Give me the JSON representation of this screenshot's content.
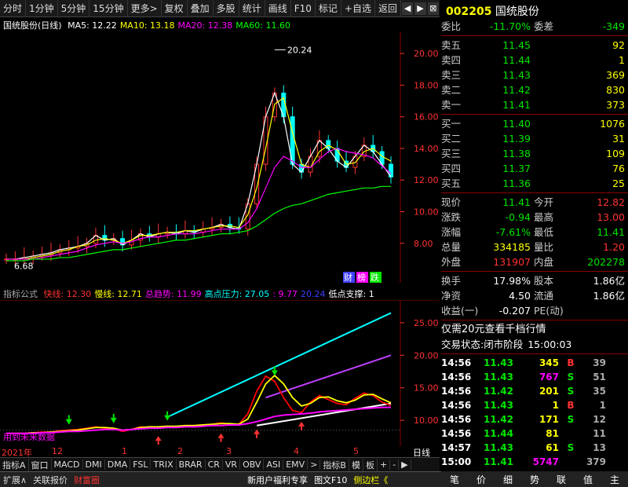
{
  "toolbar": {
    "items": [
      "分时",
      "1分钟",
      "5分钟",
      "15分钟",
      "更多>",
      "复权",
      "叠加",
      "多股",
      "统计",
      "画线",
      "F10",
      "标记",
      "+自选",
      "返回"
    ],
    "btns": [
      "◀",
      "▶",
      "⊠"
    ]
  },
  "symbol": {
    "code": "002205",
    "name": "国统股份"
  },
  "main": {
    "title": "国统股份(日线)",
    "ma": [
      {
        "label": "MA5: 12.22",
        "color": "#ffffff"
      },
      {
        "label": "MA10: 13.18",
        "color": "#ffff00"
      },
      {
        "label": "MA20: 12.38",
        "color": "#ff00ff"
      },
      {
        "label": "MA60: 11.60",
        "color": "#00ff00"
      }
    ],
    "high_label": "20.24",
    "low_label": "6.68",
    "price_axis": [
      "20.00",
      "18.00",
      "16.00",
      "14.00",
      "12.00",
      "10.00",
      "8.00"
    ],
    "badges": [
      "财",
      "榜",
      "跌"
    ]
  },
  "indicator": {
    "name": "指标公式",
    "fields": [
      {
        "label": "快线: 12.30",
        "color": "#ff3232"
      },
      {
        "label": "慢线: 12.71",
        "color": "#ffff00"
      },
      {
        "label": "总趋势: 11.99",
        "color": "#ff00ff"
      },
      {
        "label": "高点压力: 27.05",
        "color": "#00ffff"
      },
      {
        "label": ": 9.77",
        "color": "#ff00ff"
      },
      {
        "label": "20.24",
        "color": "#4040ff"
      },
      {
        "label": "低点支撑: 1",
        "color": "#ffffff"
      }
    ],
    "axis": [
      "25.00",
      "20.00",
      "15.00",
      "10.00"
    ],
    "note": "用到未来数据"
  },
  "dates": [
    "2021年",
    "12",
    "1",
    "2",
    "3",
    "4",
    "5"
  ],
  "date_right": "日线",
  "order_book": {
    "weibi": {
      "label": "委比",
      "value": "-11.70%",
      "diff_label": "委差",
      "diff": "-349"
    },
    "sell": [
      {
        "label": "卖五",
        "price": "11.45",
        "qty": "92"
      },
      {
        "label": "卖四",
        "price": "11.44",
        "qty": "1"
      },
      {
        "label": "卖三",
        "price": "11.43",
        "qty": "369"
      },
      {
        "label": "卖二",
        "price": "11.42",
        "qty": "830"
      },
      {
        "label": "卖一",
        "price": "11.41",
        "qty": "373"
      }
    ],
    "buy": [
      {
        "label": "买一",
        "price": "11.40",
        "qty": "1076"
      },
      {
        "label": "买二",
        "price": "11.39",
        "qty": "31"
      },
      {
        "label": "买三",
        "price": "11.38",
        "qty": "109"
      },
      {
        "label": "买四",
        "price": "11.37",
        "qty": "76"
      },
      {
        "label": "买五",
        "price": "11.36",
        "qty": "25"
      }
    ]
  },
  "quote": [
    {
      "l1": "现价",
      "v1": "11.41",
      "c1": "#00e600",
      "l2": "今开",
      "v2": "12.82",
      "c2": "#ff3232"
    },
    {
      "l1": "涨跌",
      "v1": "-0.94",
      "c1": "#00e600",
      "l2": "最高",
      "v2": "13.00",
      "c2": "#ff3232"
    },
    {
      "l1": "涨幅",
      "v1": "-7.61%",
      "c1": "#00e600",
      "l2": "最低",
      "v2": "11.41",
      "c2": "#00e600"
    },
    {
      "l1": "总量",
      "v1": "334185",
      "c1": "#ffff00",
      "l2": "量比",
      "v2": "1.20",
      "c2": "#ff3232"
    },
    {
      "l1": "外盘",
      "v1": "131907",
      "c1": "#ff3232",
      "l2": "内盘",
      "v2": "202278",
      "c2": "#00e600"
    }
  ],
  "stats": [
    {
      "l1": "换手",
      "v1": "17.98%",
      "l2": "股本",
      "v2": "1.86亿"
    },
    {
      "l1": "净资",
      "v1": "4.50",
      "l2": "流通",
      "v2": "1.86亿"
    },
    {
      "l1": "收益(一)",
      "v1": "-0.207",
      "l2": "PE(动)",
      "v2": ""
    }
  ],
  "promo": "仅需20元查看千档行情",
  "trade_status": {
    "label": "交易状态:",
    "value": "闭市阶段",
    "time": "15:00:03"
  },
  "trades": [
    {
      "t": "14:56",
      "p": "11.43",
      "v": "345",
      "vc": "#ffff00",
      "s": "B",
      "sc": "#ff3232",
      "n": "39"
    },
    {
      "t": "14:56",
      "p": "11.43",
      "v": "767",
      "vc": "#ff00ff",
      "s": "S",
      "sc": "#00e600",
      "n": "51"
    },
    {
      "t": "14:56",
      "p": "11.42",
      "v": "201",
      "vc": "#ffff00",
      "s": "S",
      "sc": "#00e600",
      "n": "35"
    },
    {
      "t": "14:56",
      "p": "11.43",
      "v": "1",
      "vc": "#ffff00",
      "s": "B",
      "sc": "#ff3232",
      "n": "1"
    },
    {
      "t": "14:56",
      "p": "11.42",
      "v": "171",
      "vc": "#ffff00",
      "s": "S",
      "sc": "#00e600",
      "n": "12"
    },
    {
      "t": "14:56",
      "p": "11.44",
      "v": "81",
      "vc": "#ffff00",
      "s": "",
      "sc": "#00e600",
      "n": "11"
    },
    {
      "t": "14:57",
      "p": "11.43",
      "v": "61",
      "vc": "#ffff00",
      "s": "S",
      "sc": "#00e600",
      "n": "13"
    },
    {
      "t": "15:00",
      "p": "11.41",
      "v": "5747",
      "vc": "#ff00ff",
      "s": "",
      "sc": "#00e600",
      "n": "379"
    }
  ],
  "bottom_tabs": [
    "指标A",
    "窗口",
    "MACD",
    "DMI",
    "DMA",
    "FSL",
    "TRIX",
    "BRAR",
    "CR",
    "VR",
    "OBV",
    "ASI",
    "EMV",
    ">",
    "指标B",
    "模",
    "板",
    "+",
    "-",
    "▶"
  ],
  "status_bar": [
    "扩展∧",
    "关联报价",
    "财富圈",
    "新用户福利专享",
    "图文F10",
    "侧边栏《"
  ],
  "side_tabs": [
    "笔",
    "价",
    "细",
    "势",
    "联",
    "值",
    "主"
  ],
  "colors": {
    "up": "#ff3232",
    "down": "#00e600",
    "fast": "#ff0000",
    "slow": "#ffff00",
    "trend": "#ff00ff",
    "resist": "#00ffff"
  },
  "chart_data": [
    {
      "type": "candlestick",
      "title": "国统股份(日线)",
      "ylim": [
        6.5,
        21.0
      ],
      "series": [
        {
          "name": "MA5",
          "values": [
            7.0,
            7.0,
            7.1,
            7.2,
            7.3,
            7.4,
            7.6,
            7.7,
            7.8,
            8.0,
            8.5,
            8.2,
            8.3,
            7.9,
            8.2,
            8.6,
            8.4,
            8.6,
            8.7,
            8.6,
            8.8,
            8.7,
            8.9,
            9.0,
            9.2,
            9.0,
            8.9,
            10.5,
            13.0,
            16.0,
            17.5,
            16.0,
            13.0,
            12.5,
            13.5,
            14.5,
            14.0,
            13.2,
            12.8,
            13.5,
            14.2,
            13.8,
            13.0,
            12.2
          ]
        },
        {
          "name": "MA10",
          "values": [
            7.0,
            7.0,
            7.0,
            7.1,
            7.2,
            7.3,
            7.5,
            7.6,
            7.8,
            7.9,
            8.2,
            8.3,
            8.2,
            8.0,
            8.2,
            8.5,
            8.5,
            8.6,
            8.7,
            8.7,
            8.8,
            8.8,
            8.9,
            9.0,
            9.1,
            9.1,
            9.0,
            9.8,
            11.5,
            14.0,
            16.8,
            17.2,
            15.0,
            13.0,
            12.8,
            13.8,
            14.2,
            13.9,
            13.0,
            13.1,
            13.8,
            14.0,
            13.5,
            13.2
          ]
        },
        {
          "name": "MA20",
          "values": [
            7.0,
            7.0,
            7.0,
            7.0,
            7.1,
            7.2,
            7.3,
            7.4,
            7.5,
            7.7,
            7.9,
            8.0,
            8.1,
            8.0,
            8.1,
            8.3,
            8.4,
            8.4,
            8.5,
            8.6,
            8.6,
            8.6,
            8.7,
            8.8,
            8.9,
            8.9,
            8.9,
            9.3,
            10.2,
            11.5,
            12.8,
            13.5,
            13.2,
            12.8,
            12.8,
            13.3,
            13.8,
            14.0,
            13.8,
            13.7,
            13.6,
            13.4,
            12.9,
            12.4
          ]
        },
        {
          "name": "MA60",
          "values": [
            6.9,
            6.9,
            6.9,
            7.0,
            7.0,
            7.0,
            7.1,
            7.1,
            7.2,
            7.3,
            7.4,
            7.5,
            7.6,
            7.6,
            7.7,
            7.8,
            7.9,
            8.0,
            8.1,
            8.2,
            8.2,
            8.3,
            8.4,
            8.5,
            8.6,
            8.6,
            8.7,
            8.8,
            9.1,
            9.5,
            9.9,
            10.2,
            10.4,
            10.5,
            10.7,
            10.9,
            11.1,
            11.2,
            11.3,
            11.4,
            11.5,
            11.5,
            11.6,
            11.6
          ]
        }
      ],
      "high": 20.24,
      "low": 6.68
    },
    {
      "type": "line",
      "title": "指标公式",
      "ylim": [
        7,
        28
      ],
      "series": [
        {
          "name": "快线",
          "values": [
            8.0,
            8.0,
            8.0,
            8.1,
            8.2,
            8.2,
            8.4,
            8.5,
            8.6,
            8.8,
            9.0,
            8.8,
            8.7,
            8.3,
            8.6,
            9.0,
            8.9,
            9.0,
            9.1,
            9.0,
            9.2,
            9.2,
            9.3,
            9.4,
            9.6,
            9.4,
            9.4,
            11.0,
            14.5,
            16.8,
            16.0,
            13.5,
            11.5,
            11.2,
            12.8,
            13.8,
            13.2,
            12.6,
            12.4,
            13.4,
            14.2,
            13.8,
            12.8,
            12.3
          ]
        },
        {
          "name": "慢线",
          "values": [
            8.0,
            8.0,
            8.0,
            8.1,
            8.1,
            8.2,
            8.3,
            8.4,
            8.5,
            8.7,
            8.9,
            8.9,
            8.8,
            8.5,
            8.6,
            8.9,
            9.0,
            9.0,
            9.1,
            9.1,
            9.2,
            9.2,
            9.3,
            9.4,
            9.5,
            9.5,
            9.4,
            10.2,
            12.8,
            15.6,
            16.9,
            15.6,
            13.5,
            12.2,
            12.6,
            13.5,
            13.6,
            13.0,
            12.7,
            13.1,
            13.9,
            14.0,
            13.3,
            12.7
          ]
        },
        {
          "name": "总趋势",
          "values": [
            8.0,
            8.0,
            8.0,
            8.0,
            8.1,
            8.1,
            8.2,
            8.3,
            8.3,
            8.4,
            8.5,
            8.6,
            8.6,
            8.5,
            8.6,
            8.7,
            8.8,
            8.8,
            8.9,
            8.9,
            9.0,
            9.0,
            9.1,
            9.2,
            9.2,
            9.3,
            9.3,
            9.5,
            9.8,
            10.2,
            10.6,
            10.8,
            10.9,
            11.0,
            11.1,
            11.3,
            11.4,
            11.5,
            11.6,
            11.7,
            11.8,
            11.9,
            12.0,
            11.99
          ]
        }
      ]
    }
  ]
}
